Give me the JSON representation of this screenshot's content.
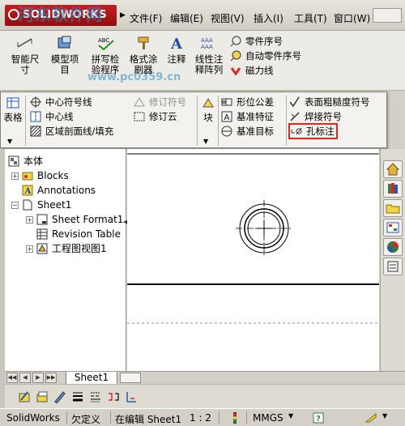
{
  "title_bar": {
    "logo_text": "SOLIDWORKS",
    "watermark": "河东软件网",
    "watermark_url": "www.pc0359.cn",
    "menus": [
      "文件(F)",
      "编辑(E)",
      "视图(V)",
      "插入(I)",
      "工具(T)",
      "窗口(W)"
    ]
  },
  "command_manager": {
    "buttons": [
      {
        "label_1": "智能尺",
        "label_2": "寸",
        "icon": "smart-dimension-icon"
      },
      {
        "label_1": "模型项",
        "label_2": "目",
        "icon": "model-items-icon"
      },
      {
        "label_1": "拼写检",
        "label_2": "验程序",
        "icon": "spell-check-icon"
      },
      {
        "label_1": "格式涂",
        "label_2": "刷器",
        "icon": "format-painter-icon"
      },
      {
        "label_1": "注释",
        "label_2": "",
        "icon": "note-icon"
      },
      {
        "label_1": "线性注",
        "label_2": "释阵列",
        "icon": "linear-note-pattern-icon"
      }
    ],
    "right_list": [
      "零件序号",
      "自动零件序号",
      "磁力线"
    ]
  },
  "flyout": {
    "table_label": "表格",
    "col1": [
      "中心符号线",
      "中心线",
      "区域剖面线/填充"
    ],
    "col2": [
      "修订符号",
      "修订云"
    ],
    "block_label": "块",
    "col3": [
      "形位公差",
      "基准特征",
      "基准目标"
    ],
    "col4": [
      "表面粗糙度符号",
      "焊接符号",
      "孔标注"
    ],
    "highlight_color": "#e8231b"
  },
  "tree": {
    "root": "本体",
    "items": [
      "Blocks",
      "Annotations",
      "Sheet1",
      "Sheet Format1",
      "Revision Table",
      "工程图视图1"
    ]
  },
  "sheet_tab": "Sheet1",
  "status": {
    "app": "SolidWorks",
    "state": "欠定义",
    "editing": "在编辑 Sheet1",
    "scale": "1 : 2",
    "units": "MMGS"
  }
}
